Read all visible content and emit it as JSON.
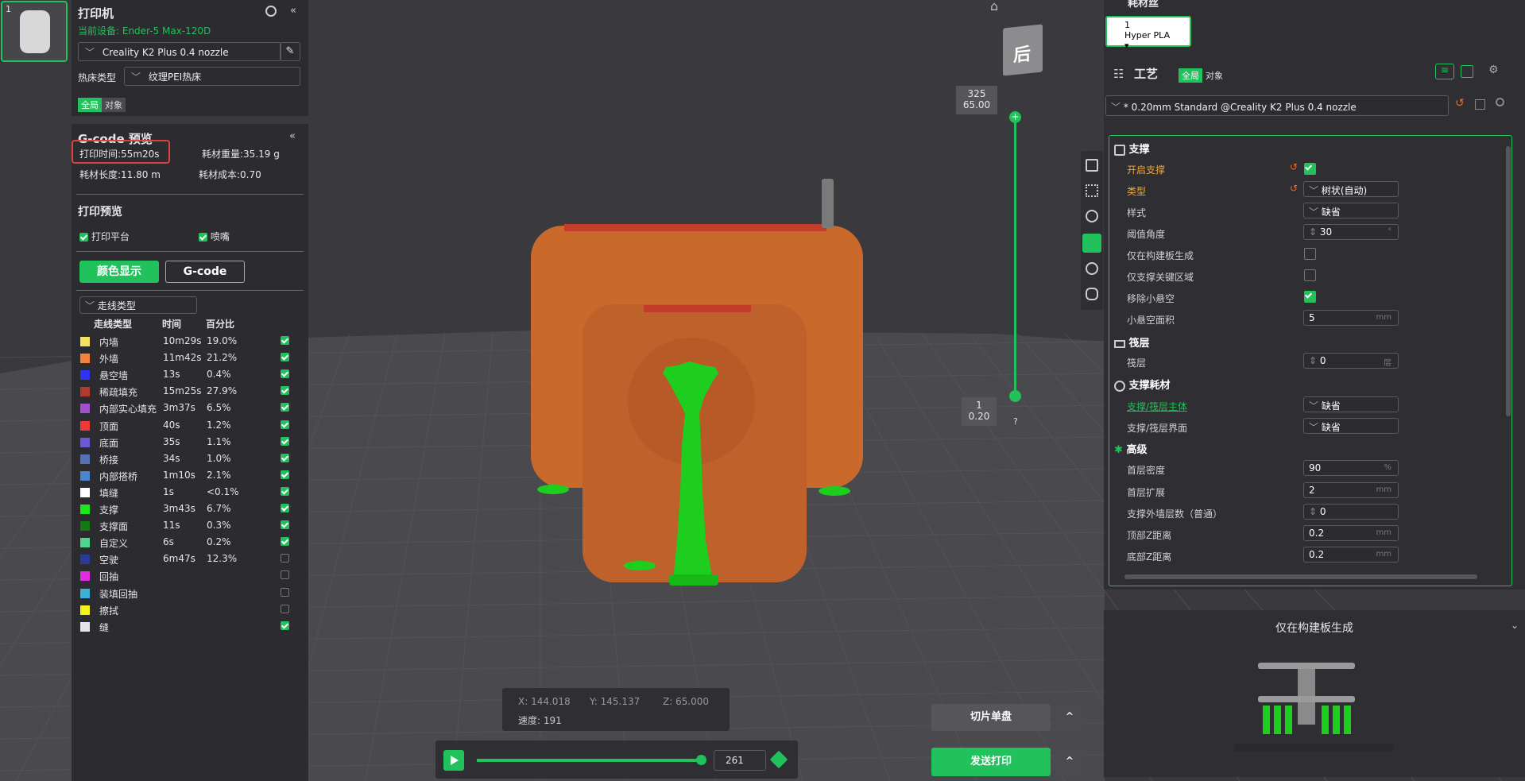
{
  "left_panel": {
    "printer_title": "打印机",
    "current_device": "当前设备: Ender-5 Max-120D",
    "printer_preset": "Creality K2 Plus 0.4 nozzle",
    "bed_type_label": "热床类型",
    "bed_type_value": "纹理PEI热床",
    "scope_global": "全局",
    "scope_object": "对象",
    "gcode_preview_title": "G-code 预览",
    "print_time": "打印时间:55m20s",
    "filament_weight": "耗材重量:35.19 g",
    "filament_length": "耗材长度:11.80 m",
    "filament_cost": "耗材成本:0.70",
    "print_preview_title": "打印预览",
    "show_plate": "打印平台",
    "show_nozzle": "喷嘴",
    "color_display_button": "颜色显示",
    "gcode_button": "G-code",
    "line_type_dropdown": "走线类型",
    "col_type": "走线类型",
    "col_time": "时间",
    "col_percent": "百分比",
    "rows": [
      {
        "name": "内墙",
        "time": "10m29s",
        "pct": "19.0%",
        "color": "#f5e35e",
        "checked": true
      },
      {
        "name": "外墙",
        "time": "11m42s",
        "pct": "21.2%",
        "color": "#f5823c",
        "checked": true
      },
      {
        "name": "悬空墙",
        "time": "13s",
        "pct": "0.4%",
        "color": "#2d34f5",
        "checked": true
      },
      {
        "name": "稀疏填充",
        "time": "15m25s",
        "pct": "27.9%",
        "color": "#b23a2e",
        "checked": true
      },
      {
        "name": "内部实心填充",
        "time": "3m37s",
        "pct": "6.5%",
        "color": "#a04fd0",
        "checked": true
      },
      {
        "name": "顶面",
        "time": "40s",
        "pct": "1.2%",
        "color": "#f03a3a",
        "checked": true
      },
      {
        "name": "底面",
        "time": "35s",
        "pct": "1.1%",
        "color": "#6a5ad6",
        "checked": true
      },
      {
        "name": "桥接",
        "time": "34s",
        "pct": "1.0%",
        "color": "#5572b8",
        "checked": true
      },
      {
        "name": "内部搭桥",
        "time": "1m10s",
        "pct": "2.1%",
        "color": "#4d84cf",
        "checked": true
      },
      {
        "name": "填缝",
        "time": "1s",
        "pct": "<0.1%",
        "color": "#ffffff",
        "checked": true
      },
      {
        "name": "支撑",
        "time": "3m43s",
        "pct": "6.7%",
        "color": "#1ae81a",
        "checked": true
      },
      {
        "name": "支撑面",
        "time": "11s",
        "pct": "0.3%",
        "color": "#117a11",
        "checked": true
      },
      {
        "name": "自定义",
        "time": "6s",
        "pct": "0.2%",
        "color": "#4fd68a",
        "checked": true
      },
      {
        "name": "空驶",
        "time": "6m47s",
        "pct": "12.3%",
        "color": "#2b3b9a",
        "checked": false
      },
      {
        "name": "回抽",
        "time": "",
        "pct": "",
        "color": "#e22ee2",
        "checked": false
      },
      {
        "name": "装填回抽",
        "time": "",
        "pct": "",
        "color": "#3bb0d6",
        "checked": false
      },
      {
        "name": "擦拭",
        "time": "",
        "pct": "",
        "color": "#f5f51a",
        "checked": false
      },
      {
        "name": "缝",
        "time": "",
        "pct": "",
        "color": "#e6e6e6",
        "checked": true
      }
    ]
  },
  "viewport": {
    "view_cube_label": "后",
    "layer_top": "325",
    "layer_top_z": "65.00",
    "layer_bottom": "1",
    "layer_bottom_z": "0.20",
    "help_mark": "?",
    "coord_x": "X: 144.018",
    "coord_y": "Y: 145.137",
    "coord_z": "Z: 65.000",
    "speed": "速度: 191",
    "move_value": "261",
    "slice_plate": "切片单盘",
    "send_print": "发送打印",
    "caret": "^"
  },
  "right_panel": {
    "filament_title": "耗材丝",
    "filament_slot": "1",
    "filament_type": "Hyper PLA",
    "process_title": "工艺",
    "scope_global": "全局",
    "scope_object": "对象",
    "process_preset": "* 0.20mm Standard @Creality K2 Plus 0.4 nozzle",
    "sections": {
      "support": "支撑",
      "raft": "筏层",
      "support_filament": "支撑耗材",
      "advanced": "高级"
    },
    "params": {
      "enable_support": "开启支撑",
      "type": "类型",
      "type_value": "树状(自动)",
      "style": "样式",
      "style_value": "缺省",
      "threshold_angle": "阈值角度",
      "threshold_value": "30",
      "threshold_unit": "°",
      "build_plate_only": "仅在构建板生成",
      "critical_only": "仅支撑关键区域",
      "remove_small": "移除小悬空",
      "small_area": "小悬空面积",
      "small_area_value": "5",
      "mm": "mm",
      "raft_layers": "筏层",
      "raft_value": "0",
      "layer_unit": "层",
      "support_base": "支撑/筏层主体",
      "support_base_value": "缺省",
      "support_interface": "支撑/筏层界面",
      "support_interface_value": "缺省",
      "first_density": "首层密度",
      "first_density_value": "90",
      "percent": "%",
      "first_expand": "首层扩展",
      "first_expand_value": "2",
      "wall_count": "支撑外墙层数（普通）",
      "wall_count_value": "0",
      "top_z": "顶部Z距离",
      "top_z_value": "0.2",
      "bottom_z": "底部Z距离",
      "bottom_z_value": "0.2"
    },
    "tip_title": "仅在构建板生成"
  }
}
